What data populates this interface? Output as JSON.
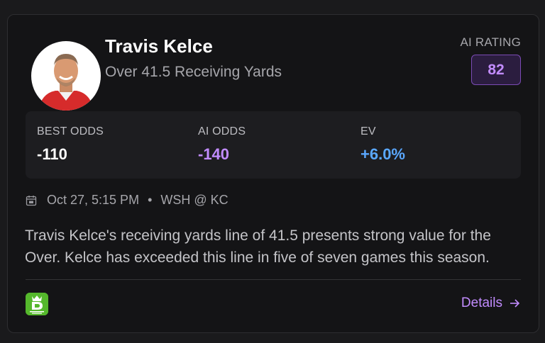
{
  "player": {
    "name": "Travis Kelce",
    "prop": "Over 41.5 Receiving Yards",
    "avatar_icon": "player-headshot"
  },
  "rating": {
    "label": "AI RATING",
    "value": "82"
  },
  "odds": [
    {
      "label": "BEST ODDS",
      "value": "-110",
      "color": "#ffffff"
    },
    {
      "label": "AI ODDS",
      "value": "-140",
      "color": "#c28cff"
    },
    {
      "label": "EV",
      "value": "+6.0%",
      "color": "#5aa8ff"
    }
  ],
  "game": {
    "icon": "calendar-icon",
    "datetime": "Oct 27, 5:15 PM",
    "separator": "•",
    "matchup": "WSH @ KC"
  },
  "analysis": "Travis Kelce's receiving yards line of 41.5 presents strong value for the Over. Kelce has exceeded this line in five of seven games this season.",
  "footer": {
    "book_logo": "draftkings-sportsbook-logo",
    "details_label": "Details",
    "details_icon": "arrow-right-icon"
  },
  "colors": {
    "accent": "#c28cff",
    "ev_blue": "#5aa8ff",
    "card_bg": "#141416",
    "panel_bg": "#1d1d20",
    "book_green": "#55b82c"
  }
}
